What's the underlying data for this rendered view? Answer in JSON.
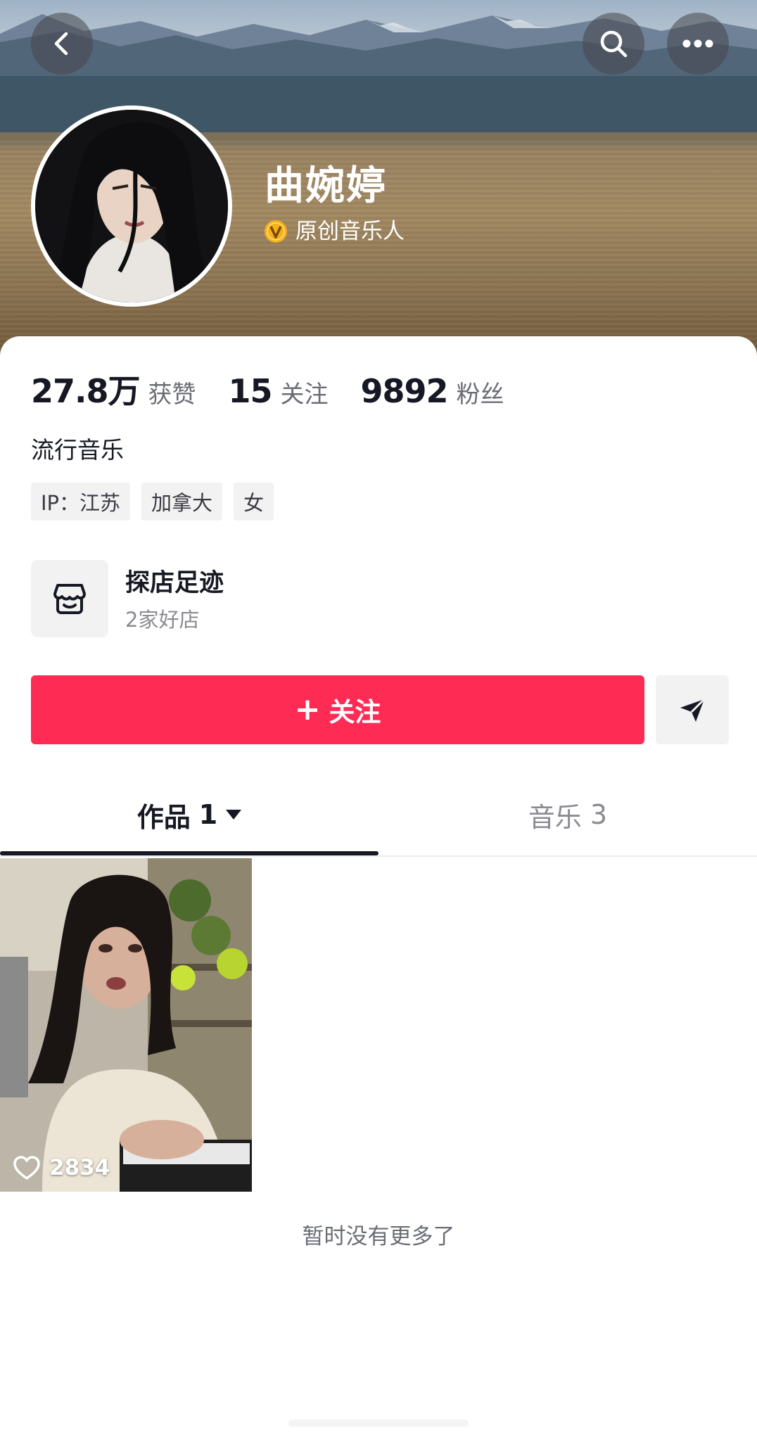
{
  "header": {
    "back_icon": "chevron-left-icon",
    "search_icon": "search-icon",
    "more_icon": "ellipsis-icon"
  },
  "profile": {
    "nickname": "曲婉婷",
    "verification_badge_icon": "verified-v-icon",
    "verification_label": "原创音乐人"
  },
  "stats": [
    {
      "value": "27.8万",
      "label": "获赞"
    },
    {
      "value": "15",
      "label": "关注"
    },
    {
      "value": "9892",
      "label": "粉丝"
    }
  ],
  "bio": "流行音乐",
  "tags": [
    "IP：江苏",
    "加拿大",
    "女"
  ],
  "shop": {
    "icon": "storefront-icon",
    "title": "探店足迹",
    "subtitle": "2家好店"
  },
  "actions": {
    "follow_plus": "+",
    "follow_label": "关注",
    "share_icon": "paper-plane-icon"
  },
  "tabs": [
    {
      "label": "作品",
      "count": "1",
      "selected": true
    },
    {
      "label": "音乐",
      "count": "3",
      "selected": false
    }
  ],
  "videos": [
    {
      "like_icon": "heart-outline-icon",
      "likes": "2834"
    }
  ],
  "footer_text": "暂时没有更多了",
  "colors": {
    "accent": "#fe2c55",
    "badge": "#f5b01b",
    "text_primary": "#161823",
    "text_secondary": "#8a8b91"
  }
}
